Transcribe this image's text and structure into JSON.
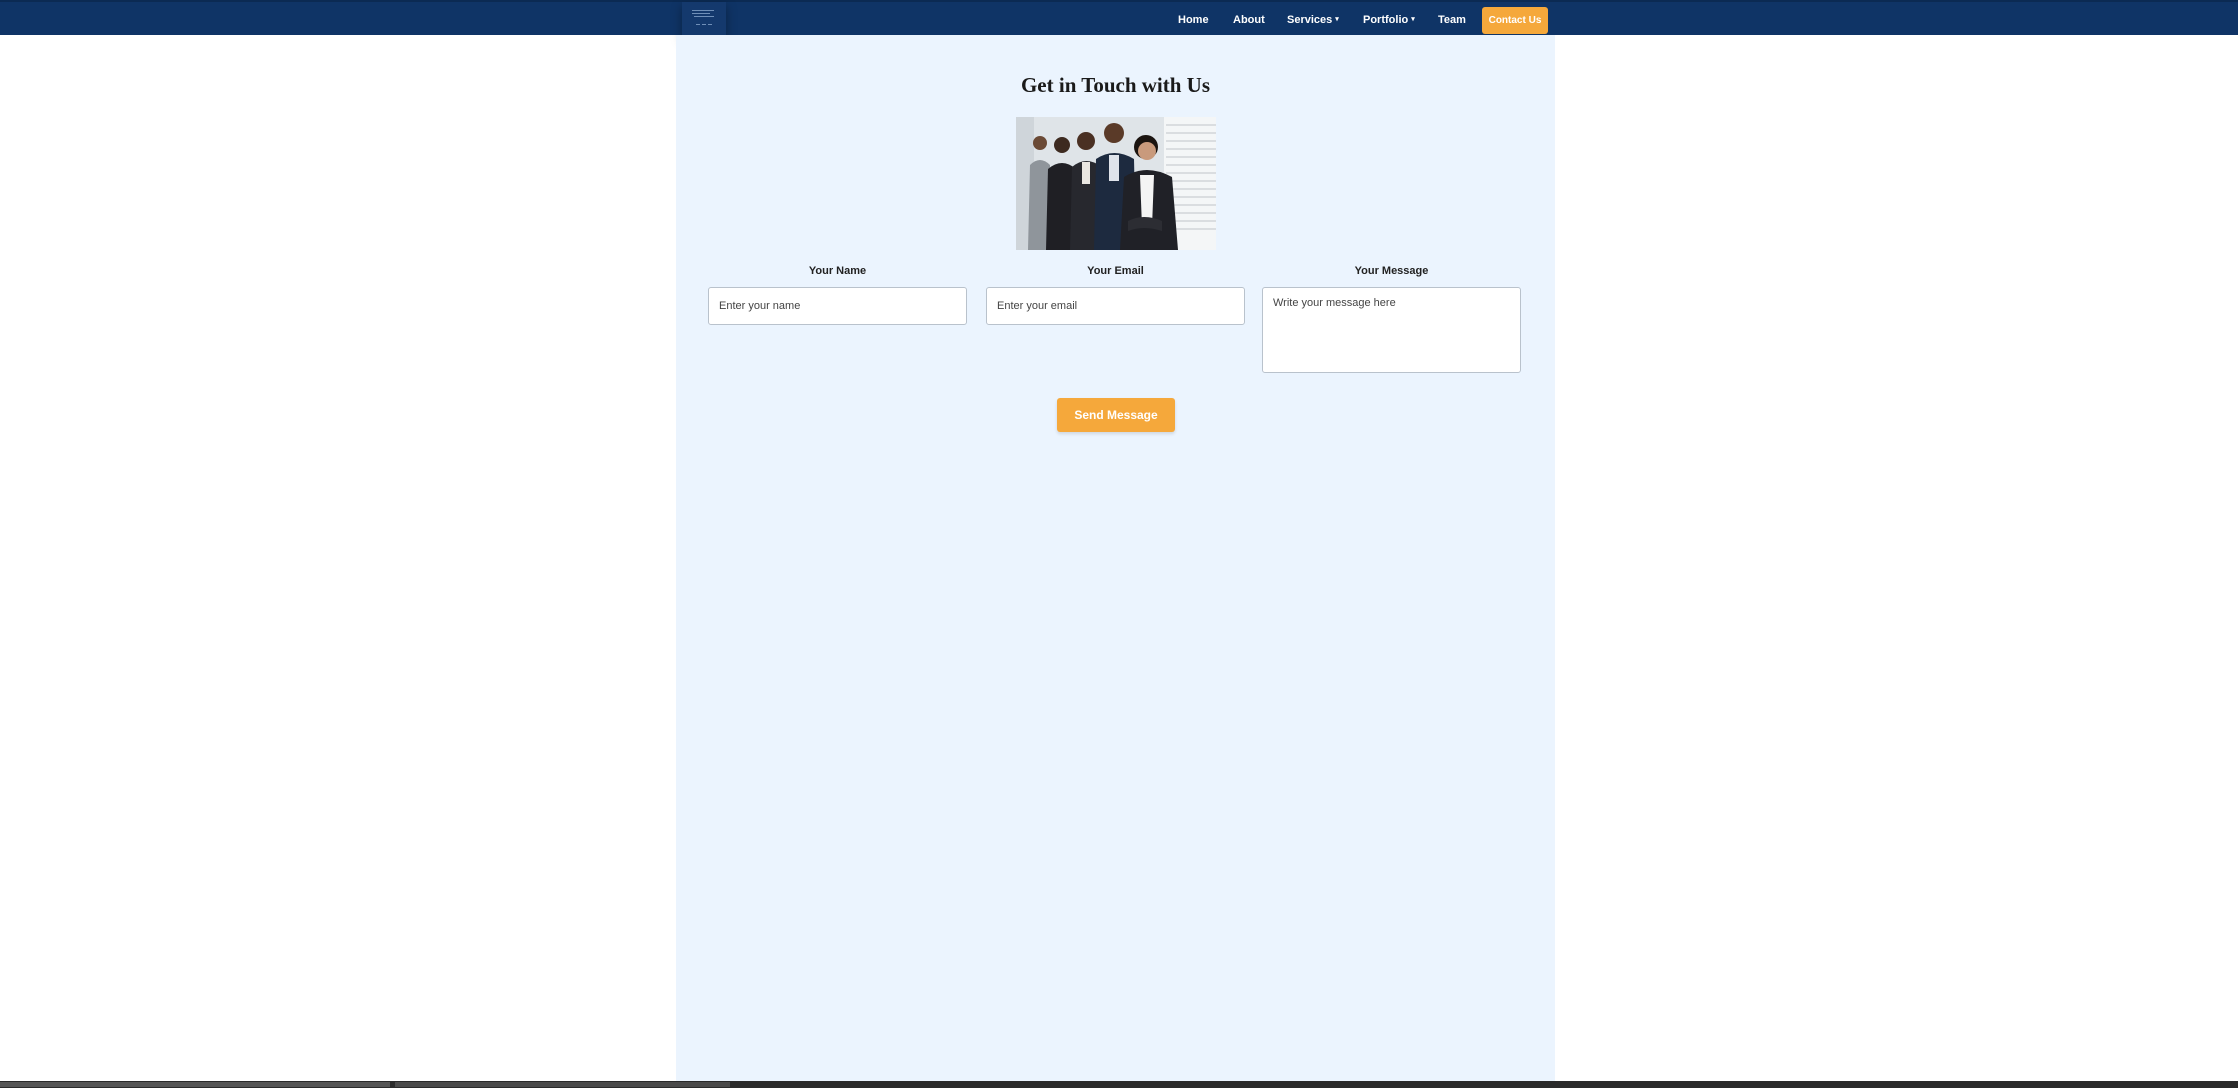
{
  "nav": {
    "items": [
      {
        "label": "Home"
      },
      {
        "label": "About"
      },
      {
        "label": "Services",
        "dropdown": true
      },
      {
        "label": "Portfolio",
        "dropdown": true
      },
      {
        "label": "Team"
      }
    ],
    "contact_label": "Contact Us",
    "caret": "▾"
  },
  "main": {
    "title": "Get in Touch with Us",
    "form": {
      "name_label": "Your Name",
      "name_placeholder": "Enter your name",
      "email_label": "Your Email",
      "email_placeholder": "Enter your email",
      "message_label": "Your Message",
      "message_placeholder": "Write your message here",
      "submit_label": "Send Message"
    }
  },
  "colors": {
    "navbar": "#0f3466",
    "accent": "#f5a83b",
    "content_bg": "#ebf4fe"
  },
  "icons": {
    "logo": "company-logo",
    "dropdown": "chevron-down-icon"
  }
}
